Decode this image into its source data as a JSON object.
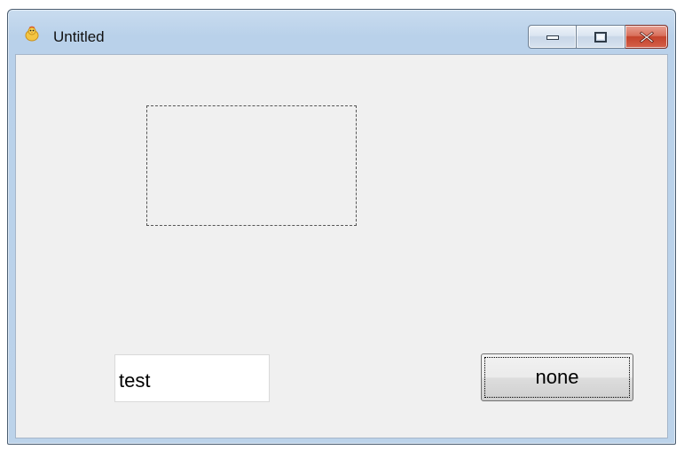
{
  "window": {
    "title": "Untitled",
    "app_icon": "app-chick-icon",
    "caption_buttons": {
      "minimize_icon": "minimize-icon",
      "maximize_icon": "maximize-icon",
      "close_icon": "close-icon"
    }
  },
  "form": {
    "text_input": {
      "value": "test",
      "placeholder": ""
    },
    "button": {
      "label": "none"
    }
  },
  "colors": {
    "client_background": "#f0f0f0",
    "close_button": "#c4432c",
    "title_bar": "#b9d1ea"
  }
}
